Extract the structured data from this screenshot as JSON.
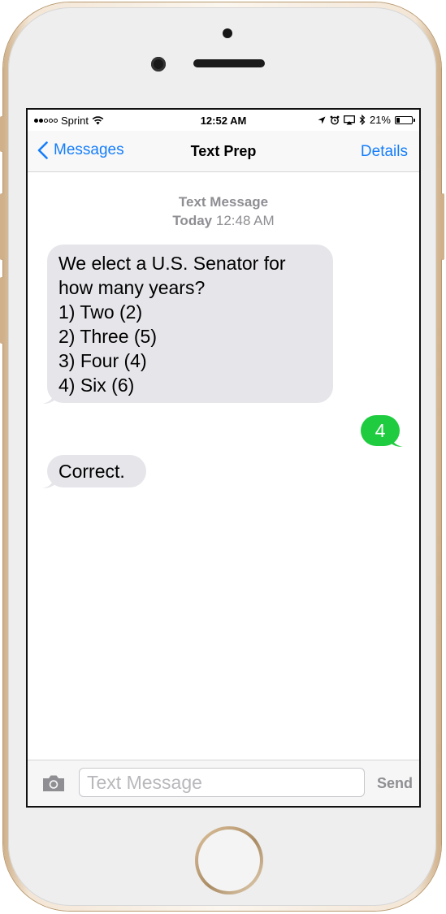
{
  "status_bar": {
    "carrier": "Sprint",
    "signal_bars": 2,
    "signal_total": 5,
    "time": "12:52 AM",
    "battery": "21%",
    "battery_level": 0.21
  },
  "nav": {
    "back_label": "Messages",
    "title": "Text Prep",
    "details_label": "Details"
  },
  "thread_header": {
    "label": "Text Message",
    "day": "Today",
    "time": "12:48 AM"
  },
  "messages": [
    {
      "direction": "incoming",
      "lines": [
        "We elect a U.S. Senator for",
        "how many years?",
        "1) Two (2)",
        "2) Three (5)",
        "3) Four (4)",
        "4) Six (6)"
      ]
    },
    {
      "direction": "outgoing",
      "text": "4"
    },
    {
      "direction": "incoming",
      "text": "Correct."
    }
  ],
  "input_bar": {
    "placeholder": "Text Message",
    "value": "",
    "send_label": "Send"
  },
  "colors": {
    "ios_blue": "#157efb",
    "incoming_bubble": "#e5e5ea",
    "outgoing_bubble": "#1fcc3f",
    "meta_gray": "#8e8e93",
    "phone_gold": "#cfb08a"
  },
  "icons": {
    "back": "chevron-left-icon",
    "wifi": "wifi-icon",
    "location": "location-arrow-icon",
    "alarm": "alarm-clock-icon",
    "airplay": "airplay-icon",
    "bluetooth": "bluetooth-icon",
    "battery": "battery-icon",
    "camera": "camera-icon"
  }
}
